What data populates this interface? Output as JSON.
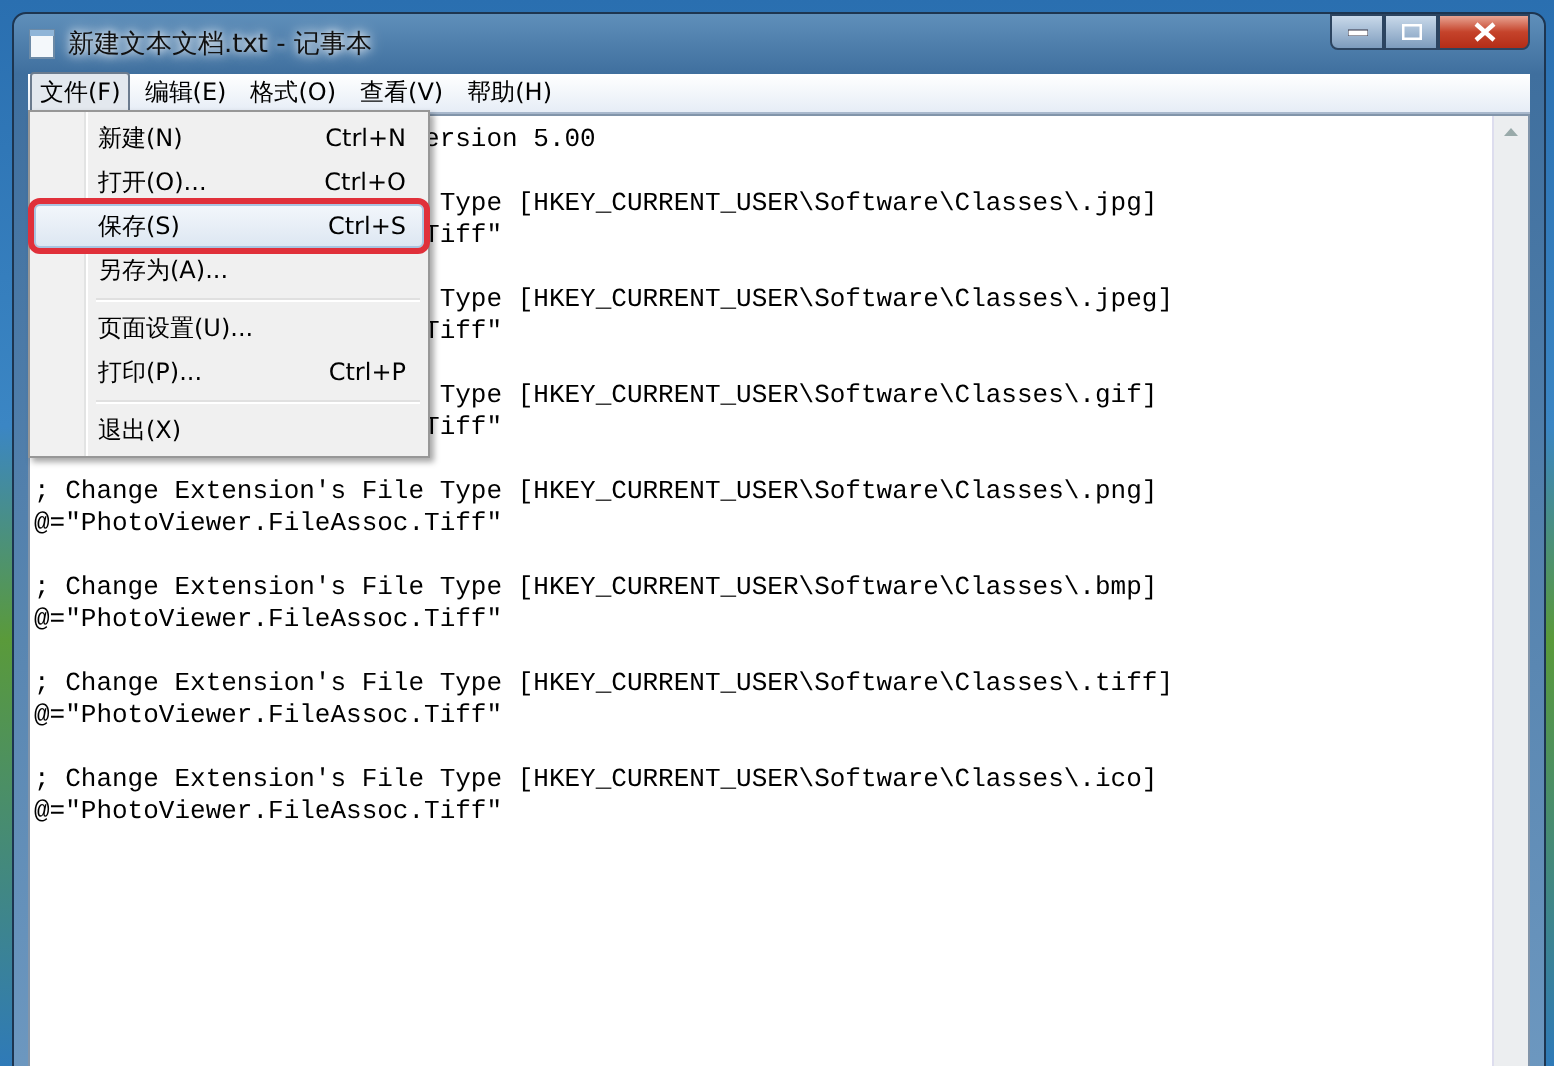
{
  "window": {
    "title": "新建文本文档.txt - 记事本"
  },
  "menu_bar": [
    {
      "label": "文件(F)",
      "selected": true
    },
    {
      "label": "编辑(E)",
      "selected": false
    },
    {
      "label": "格式(O)",
      "selected": false
    },
    {
      "label": "查看(V)",
      "selected": false
    },
    {
      "label": "帮助(H)",
      "selected": false
    }
  ],
  "file_menu": [
    {
      "kind": "item",
      "label": "新建(N)",
      "shortcut": "Ctrl+N",
      "selected": false,
      "annotated": false
    },
    {
      "kind": "item",
      "label": "打开(O)...",
      "shortcut": "Ctrl+O",
      "selected": false,
      "annotated": false
    },
    {
      "kind": "item",
      "label": "保存(S)",
      "shortcut": "Ctrl+S",
      "selected": true,
      "annotated": true
    },
    {
      "kind": "item",
      "label": "另存为(A)...",
      "selected": false,
      "annotated": false
    },
    {
      "kind": "separator"
    },
    {
      "kind": "item",
      "label": "页面设置(U)...",
      "selected": false,
      "annotated": false
    },
    {
      "kind": "item",
      "label": "打印(P)...",
      "shortcut": "Ctrl+P",
      "selected": false,
      "annotated": false
    },
    {
      "kind": "separator"
    },
    {
      "kind": "item",
      "label": "退出(X)",
      "selected": false,
      "annotated": false
    }
  ],
  "editor": {
    "lines": [
      {
        "kind": "partial",
        "text": "ersion 5.00"
      },
      {
        "kind": "blank"
      },
      {
        "kind": "partial",
        "text": " Type [HKEY_CURRENT_USER\\Software\\Classes\\.jpg]"
      },
      {
        "kind": "partial",
        "text": "Tiff\""
      },
      {
        "kind": "blank"
      },
      {
        "kind": "partial",
        "text": " Type [HKEY_CURRENT_USER\\Software\\Classes\\.jpeg]"
      },
      {
        "kind": "partial",
        "text": "Tiff\""
      },
      {
        "kind": "blank"
      },
      {
        "kind": "partial",
        "text": " Type [HKEY_CURRENT_USER\\Software\\Classes\\.gif]"
      },
      {
        "kind": "partial",
        "text": "Tiff\""
      },
      {
        "kind": "blank"
      },
      {
        "kind": "full",
        "text": "; Change Extension's File Type [HKEY_CURRENT_USER\\Software\\Classes\\.png]"
      },
      {
        "kind": "full",
        "text": "@=\"PhotoViewer.FileAssoc.Tiff\""
      },
      {
        "kind": "blank"
      },
      {
        "kind": "full",
        "text": "; Change Extension's File Type [HKEY_CURRENT_USER\\Software\\Classes\\.bmp]"
      },
      {
        "kind": "full",
        "text": "@=\"PhotoViewer.FileAssoc.Tiff\""
      },
      {
        "kind": "blank"
      },
      {
        "kind": "full",
        "text": "; Change Extension's File Type [HKEY_CURRENT_USER\\Software\\Classes\\.tiff]"
      },
      {
        "kind": "full",
        "text": "@=\"PhotoViewer.FileAssoc.Tiff\""
      },
      {
        "kind": "blank"
      },
      {
        "kind": "full",
        "text": "; Change Extension's File Type [HKEY_CURRENT_USER\\Software\\Classes\\.ico]"
      },
      {
        "kind": "full",
        "text": "@=\"PhotoViewer.FileAssoc.Tiff\""
      }
    ]
  }
}
